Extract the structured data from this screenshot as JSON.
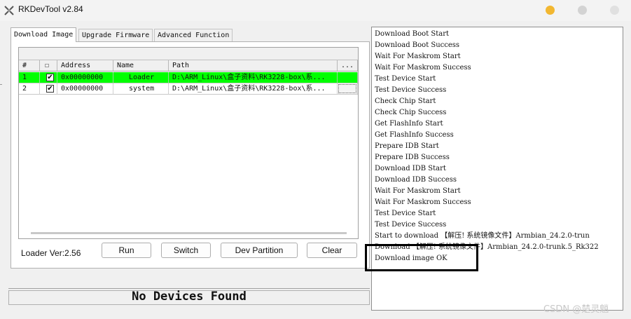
{
  "window": {
    "title": "RKDevTool v2.84"
  },
  "tabs": [
    {
      "label": "Download Image",
      "active": true
    },
    {
      "label": "Upgrade Firmware",
      "active": false
    },
    {
      "label": "Advanced Function",
      "active": false
    }
  ],
  "grid": {
    "columns": [
      "#",
      "☐",
      "Address",
      "Name",
      "Path",
      "..."
    ],
    "rows": [
      {
        "num": "1",
        "checked": "✔",
        "address": "0x00000000",
        "name": "Loader",
        "path": "D:\\ARM_Linux\\盒子资料\\RK3228-box\\系...",
        "selected": true
      },
      {
        "num": "2",
        "checked": "✔",
        "address": "0x00000000",
        "name": "system",
        "path": "D:\\ARM_Linux\\盒子资料\\RK3228-box\\系...",
        "selected": false
      }
    ]
  },
  "loader_version": "Loader Ver:2.56",
  "buttons": {
    "run": "Run",
    "switch": "Switch",
    "dev_partition": "Dev Partition",
    "clear": "Clear"
  },
  "status": "No Devices Found",
  "log": [
    "Download Boot Start",
    "Download Boot Success",
    "Wait For Maskrom Start",
    "Wait For Maskrom Success",
    "Test Device Start",
    "Test Device Success",
    "Check Chip Start",
    " Check Chip Success",
    "Get FlashInfo Start",
    "Get FlashInfo Success",
    "Prepare IDB Start",
    "Prepare IDB Success",
    "Download IDB Start",
    "Download IDB Success",
    "Wait For Maskrom Start",
    "Wait For Maskrom Success",
    "Test Device Start",
    "Test Device Success",
    "Start to download 【解压! 系统镜像文件】Armbian_24.2.0-trun",
    "Download 【解压! 系统镜像文件】Armbian_24.2.0-trunk.5_Rk322",
    "Download image OK"
  ],
  "watermark": "CSDN @楚灵魈",
  "colors": {
    "selected_row": "#00ff00",
    "minimize": "#f2b731"
  }
}
